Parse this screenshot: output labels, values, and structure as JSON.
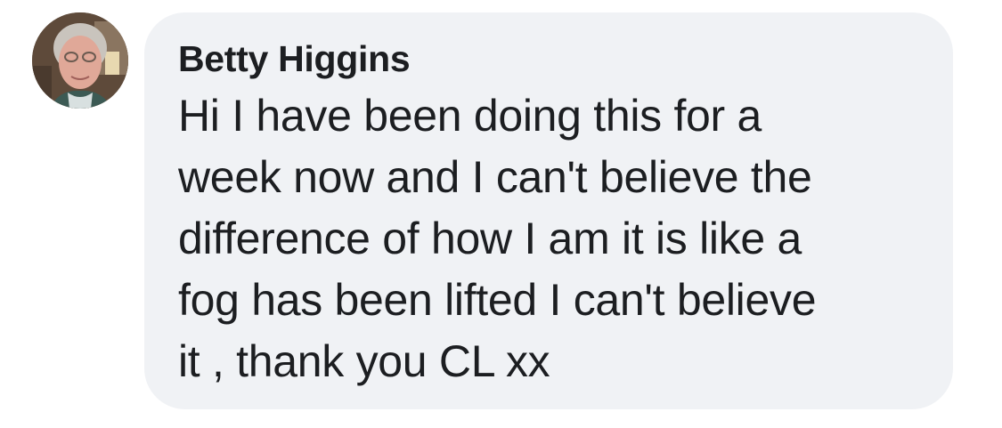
{
  "comment": {
    "author": "Betty Higgins",
    "text": "Hi I have been doing this for a\nweek now and I can't believe the\ndifference of how I am it is like a\nfog has been lifted I can't believe\nit , thank you CL xx"
  },
  "colors": {
    "bubble_bg": "#f0f2f5",
    "text": "#1c1e21",
    "action_text": "#65676b"
  },
  "icons": {
    "avatar": "profile-photo"
  }
}
